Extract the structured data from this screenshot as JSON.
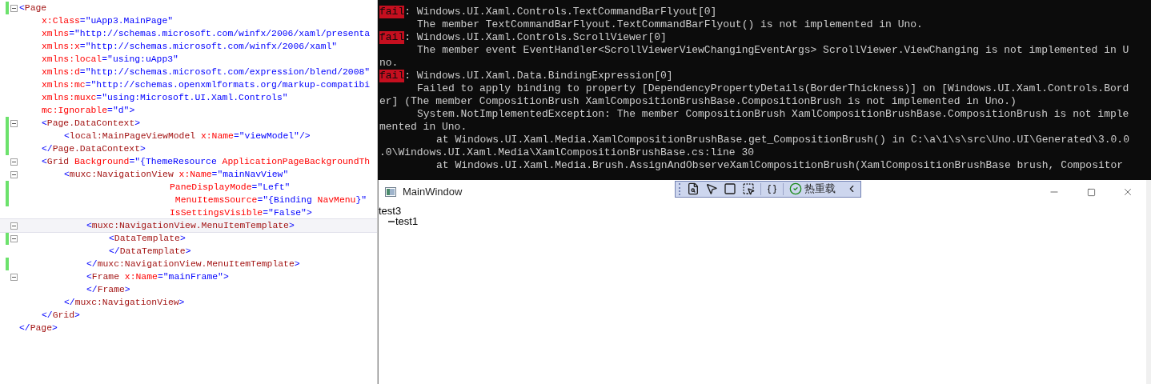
{
  "editor": {
    "lines": [
      {
        "fold": true,
        "changed": true,
        "segments": [
          {
            "kind": "punct",
            "text": "<"
          },
          {
            "kind": "tag",
            "text": "Page"
          }
        ],
        "children": [
          {
            "segments": [
              {
                "kind": "attr",
                "text": "x:Class"
              },
              {
                "kind": "punct",
                "text": "="
              },
              {
                "kind": "value",
                "text": "\"uApp3.MainPage\""
              }
            ]
          },
          {
            "segments": [
              {
                "kind": "attr",
                "text": "xmlns"
              },
              {
                "kind": "punct",
                "text": "="
              },
              {
                "kind": "value",
                "text": "\"http://schemas.microsoft.com/winfx/2006/xaml/presenta"
              }
            ]
          },
          {
            "segments": [
              {
                "kind": "attr",
                "text": "xmlns:x"
              },
              {
                "kind": "punct",
                "text": "="
              },
              {
                "kind": "value",
                "text": "\"http://schemas.microsoft.com/winfx/2006/xaml\""
              }
            ]
          },
          {
            "segments": [
              {
                "kind": "attr",
                "text": "xmlns:local"
              },
              {
                "kind": "punct",
                "text": "="
              },
              {
                "kind": "value",
                "text": "\"using:uApp3\""
              }
            ]
          },
          {
            "segments": [
              {
                "kind": "attr",
                "text": "xmlns:d"
              },
              {
                "kind": "punct",
                "text": "="
              },
              {
                "kind": "value",
                "text": "\"http://schemas.microsoft.com/expression/blend/2008\""
              }
            ]
          },
          {
            "segments": [
              {
                "kind": "attr",
                "text": "xmlns:mc"
              },
              {
                "kind": "punct",
                "text": "="
              },
              {
                "kind": "value",
                "text": "\"http://schemas.openxmlformats.org/markup-compatibi"
              }
            ]
          },
          {
            "segments": [
              {
                "kind": "attr",
                "text": "xmlns:muxc"
              },
              {
                "kind": "punct",
                "text": "="
              },
              {
                "kind": "value",
                "text": "\"using:Microsoft.UI.Xaml.Controls\""
              }
            ]
          },
          {
            "segments": [
              {
                "kind": "attr",
                "text": "mc:Ignorable"
              },
              {
                "kind": "punct",
                "text": "="
              },
              {
                "kind": "value",
                "text": "\"d\">"
              }
            ]
          },
          {
            "fold": true,
            "changed": true,
            "segments": [
              {
                "kind": "punct",
                "text": "<"
              },
              {
                "kind": "tag",
                "text": "Page.DataContext"
              },
              {
                "kind": "punct",
                "text": ">"
              }
            ],
            "children": [
              {
                "changed": true,
                "segments": [
                  {
                    "kind": "punct",
                    "text": "<"
                  },
                  {
                    "kind": "tag",
                    "text": "local:MainPageViewModel"
                  },
                  {
                    "kind": "attr",
                    "text": " x:Name"
                  },
                  {
                    "kind": "punct",
                    "text": "="
                  },
                  {
                    "kind": "value",
                    "text": "\"viewModel\"/>"
                  }
                ]
              }
            ]
          },
          {
            "changed": true,
            "segments": [
              {
                "kind": "punct",
                "text": "</"
              },
              {
                "kind": "tag",
                "text": "Page.DataContext"
              },
              {
                "kind": "punct",
                "text": ">"
              }
            ]
          },
          {
            "fold": true,
            "segments": [
              {
                "kind": "punct",
                "text": "<"
              },
              {
                "kind": "tag",
                "text": "Grid"
              },
              {
                "kind": "attr",
                "text": " Background"
              },
              {
                "kind": "punct",
                "text": "="
              },
              {
                "kind": "value",
                "text": "\"{ThemeResource"
              },
              {
                "kind": "attr",
                "text": " ApplicationPageBackgroundTh"
              }
            ],
            "children": [
              {
                "fold": true,
                "segments": [
                  {
                    "kind": "punct",
                    "text": "<"
                  },
                  {
                    "kind": "tag",
                    "text": "muxc:NavigationView"
                  },
                  {
                    "kind": "attr",
                    "text": " x:Name"
                  },
                  {
                    "kind": "punct",
                    "text": "="
                  },
                  {
                    "kind": "value",
                    "text": "\"mainNavView\""
                  }
                ],
                "children": [
                  {
                    "kind": "continuation",
                    "changed": true,
                    "segments": [
                      {
                        "kind": "attr",
                        "text": "PaneDisplayMode"
                      },
                      {
                        "kind": "punct",
                        "text": "="
                      },
                      {
                        "kind": "value",
                        "text": "\"Left\""
                      }
                    ]
                  },
                  {
                    "kind": "continuation",
                    "changed": true,
                    "segments": [
                      {
                        "kind": "attr",
                        "text": " MenuItemsSource"
                      },
                      {
                        "kind": "punct",
                        "text": "="
                      },
                      {
                        "kind": "value",
                        "text": "\"{Binding"
                      },
                      {
                        "kind": "attr",
                        "text": " NavMenu"
                      },
                      {
                        "kind": "value",
                        "text": "}\""
                      }
                    ]
                  },
                  {
                    "kind": "continuation",
                    "segments": [
                      {
                        "kind": "attr",
                        "text": "IsSettingsVisible"
                      },
                      {
                        "kind": "punct",
                        "text": "="
                      },
                      {
                        "kind": "value",
                        "text": "\"False\">"
                      }
                    ]
                  },
                  {
                    "fold": true,
                    "highlighted": true,
                    "segments": [
                      {
                        "kind": "punct",
                        "text": "<"
                      },
                      {
                        "kind": "tag",
                        "text": "muxc:NavigationView.MenuItemTemplate"
                      },
                      {
                        "kind": "punct",
                        "text": ">"
                      }
                    ],
                    "children": [
                      {
                        "fold": true,
                        "changed": true,
                        "segments": [
                          {
                            "kind": "punct",
                            "text": "<"
                          },
                          {
                            "kind": "tag",
                            "text": "DataTemplate"
                          },
                          {
                            "kind": "punct",
                            "text": ">"
                          }
                        ]
                      },
                      {
                        "segments": [
                          {
                            "kind": "punct",
                            "text": "</"
                          },
                          {
                            "kind": "tag",
                            "text": "DataTemplate"
                          },
                          {
                            "kind": "punct",
                            "text": ">"
                          }
                        ]
                      }
                    ]
                  },
                  {
                    "changed": true,
                    "segments": [
                      {
                        "kind": "punct",
                        "text": "</"
                      },
                      {
                        "kind": "tag",
                        "text": "muxc:NavigationView.MenuItemTemplate"
                      },
                      {
                        "kind": "punct",
                        "text": ">"
                      }
                    ]
                  },
                  {
                    "fold": true,
                    "segments": [
                      {
                        "kind": "punct",
                        "text": "<"
                      },
                      {
                        "kind": "tag",
                        "text": "Frame"
                      },
                      {
                        "kind": "attr",
                        "text": " x:Name"
                      },
                      {
                        "kind": "punct",
                        "text": "="
                      },
                      {
                        "kind": "value",
                        "text": "\"mainFrame\">"
                      }
                    ]
                  },
                  {
                    "segments": [
                      {
                        "kind": "punct",
                        "text": "</"
                      },
                      {
                        "kind": "tag",
                        "text": "Frame"
                      },
                      {
                        "kind": "punct",
                        "text": ">"
                      }
                    ]
                  }
                ]
              },
              {
                "segments": [
                  {
                    "kind": "punct",
                    "text": "</"
                  },
                  {
                    "kind": "tag",
                    "text": "muxc:NavigationView"
                  },
                  {
                    "kind": "punct",
                    "text": ">"
                  }
                ]
              }
            ]
          },
          {
            "segments": [
              {
                "kind": "punct",
                "text": "</"
              },
              {
                "kind": "tag",
                "text": "Grid"
              },
              {
                "kind": "punct",
                "text": ">"
              }
            ]
          }
        ]
      },
      {
        "segments": [
          {
            "kind": "punct",
            "text": "</"
          },
          {
            "kind": "tag",
            "text": "Page"
          },
          {
            "kind": "punct",
            "text": ">"
          }
        ]
      }
    ]
  },
  "console": {
    "lines": [
      {
        "kind": "entry",
        "label": "fail",
        "text": ": Windows.UI.Xaml.Controls.TextCommandBarFlyout[0]"
      },
      {
        "kind": "message",
        "text": "The member TextCommandBarFlyout.TextCommandBarFlyout() is not implemented in Uno."
      },
      {
        "kind": "entry",
        "label": "fail",
        "text": ": Windows.UI.Xaml.Controls.ScrollViewer[0]"
      },
      {
        "kind": "message",
        "text": "The member event EventHandler<ScrollViewerViewChangingEventArgs> ScrollViewer.ViewChanging is not implemented in U"
      },
      {
        "kind": "wrap",
        "text": "no."
      },
      {
        "kind": "entry",
        "label": "fail",
        "text": ": Windows.UI.Xaml.Data.BindingExpression[0]"
      },
      {
        "kind": "message",
        "text": "Failed to apply binding to property [DependencyPropertyDetails(BorderThickness)] on [Windows.UI.Xaml.Controls.Bord"
      },
      {
        "kind": "wrap",
        "text": "er] (The member CompositionBrush XamlCompositionBrushBase.CompositionBrush is not implemented in Uno.)"
      },
      {
        "kind": "message",
        "text": "System.NotImplementedException: The member CompositionBrush XamlCompositionBrushBase.CompositionBrush is not imple"
      },
      {
        "kind": "wrap",
        "text": "mented in Uno."
      },
      {
        "kind": "stack",
        "text": "at Windows.UI.Xaml.Media.XamlCompositionBrushBase.get_CompositionBrush() in C:\\a\\1\\s\\src\\Uno.UI\\Generated\\3.0.0"
      },
      {
        "kind": "wrap",
        "text": ".0\\Windows.UI.Xaml.Media\\XamlCompositionBrushBase.cs:line 30"
      },
      {
        "kind": "stack",
        "text": "at Windows.UI.Xaml.Media.Brush.AssignAndObserveXamlCompositionBrush(XamlCompositionBrushBase brush, Compositor"
      }
    ]
  },
  "window": {
    "title": "MainWindow",
    "toolbar": {
      "hot_reload": "热重载"
    },
    "pane": {
      "header": "test3",
      "items": [
        {
          "label": "test1"
        }
      ]
    }
  }
}
